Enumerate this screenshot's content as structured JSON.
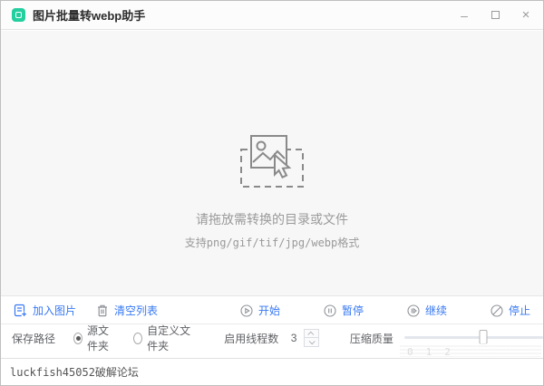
{
  "window": {
    "title": "图片批量转webp助手",
    "minimize_label": "–",
    "close_label": "×"
  },
  "colors": {
    "app_icon_green": "#23cf9e",
    "accent_blue": "#3778f3",
    "icon_gray": "#909399"
  },
  "drop_area": {
    "hint_main": "请拖放需转换的目录或文件",
    "hint_formats": "支持png/gif/tif/jpg/webp格式"
  },
  "toolbar": {
    "add_images_label": "加入图片",
    "clear_list_label": "清空列表",
    "start_label": "开始",
    "pause_label": "暂停",
    "resume_label": "继续",
    "stop_label": "停止"
  },
  "settings": {
    "save_path_label": "保存路径",
    "source_folder_label": "源文件夹",
    "custom_folder_label": "自定义文件夹",
    "thread_count_label": "启用线程数",
    "thread_count_value": "3",
    "quality_label": "压缩质量",
    "quality_slider_percent": 57,
    "slider_ticks": [
      "0",
      "1",
      "2"
    ]
  },
  "status_bar": {
    "text": "luckfish45052破解论坛"
  }
}
